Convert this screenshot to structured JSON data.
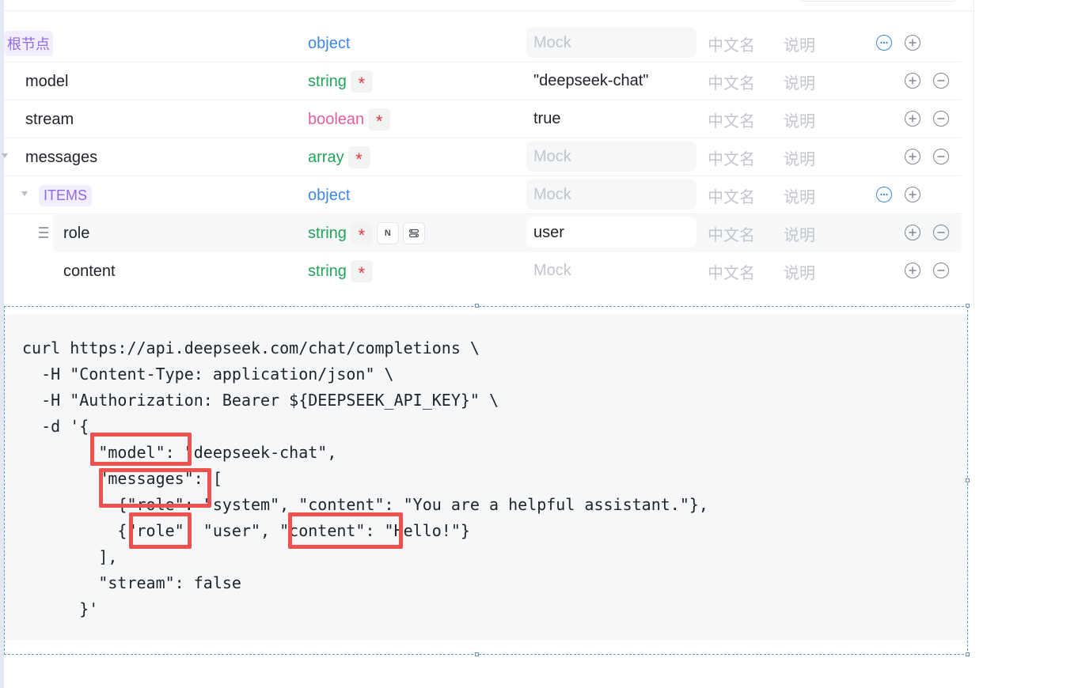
{
  "placeholders": {
    "mock": "Mock",
    "cn_name": "中文名",
    "description": "说明"
  },
  "schema_rows": [
    {
      "name": "根节点",
      "type": "object",
      "required": false,
      "value": "Mock",
      "is_placeholder": true
    },
    {
      "name": "model",
      "type": "string",
      "required": true,
      "value": "\"deepseek-chat\""
    },
    {
      "name": "stream",
      "type": "boolean",
      "required": true,
      "value": "true"
    },
    {
      "name": "messages",
      "type": "array",
      "required": true,
      "value": "Mock",
      "is_placeholder": true
    },
    {
      "name": "ITEMS",
      "type": "object",
      "required": false,
      "value": "Mock",
      "is_placeholder": true
    },
    {
      "name": "role",
      "type": "string",
      "required": true,
      "value": "user",
      "badge_n": "N"
    },
    {
      "name": "content",
      "type": "string",
      "required": true,
      "value": "Mock",
      "is_placeholder": true
    }
  ],
  "required_mark": "*",
  "code_lines": [
    "curl https://api.deepseek.com/chat/completions \\",
    "  -H \"Content-Type: application/json\" \\",
    "  -H \"Authorization: Bearer ${DEEPSEEK_API_KEY}\" \\",
    "  -d '{",
    "        \"model\": \"deepseek-chat\",",
    "        \"messages\": [",
    "          {\"role\": \"system\", \"content\": \"You are a helpful assistant.\"},",
    "          {\"role\": \"user\", \"content\": \"Hello!\"}",
    "        ],",
    "        \"stream\": false",
    "      }'"
  ],
  "colors": {
    "type_object": "#3f87e8",
    "type_string": "#22a35a",
    "type_boolean": "#e05fa3",
    "required": "#e53935",
    "highlight_box": "#f0514f"
  }
}
